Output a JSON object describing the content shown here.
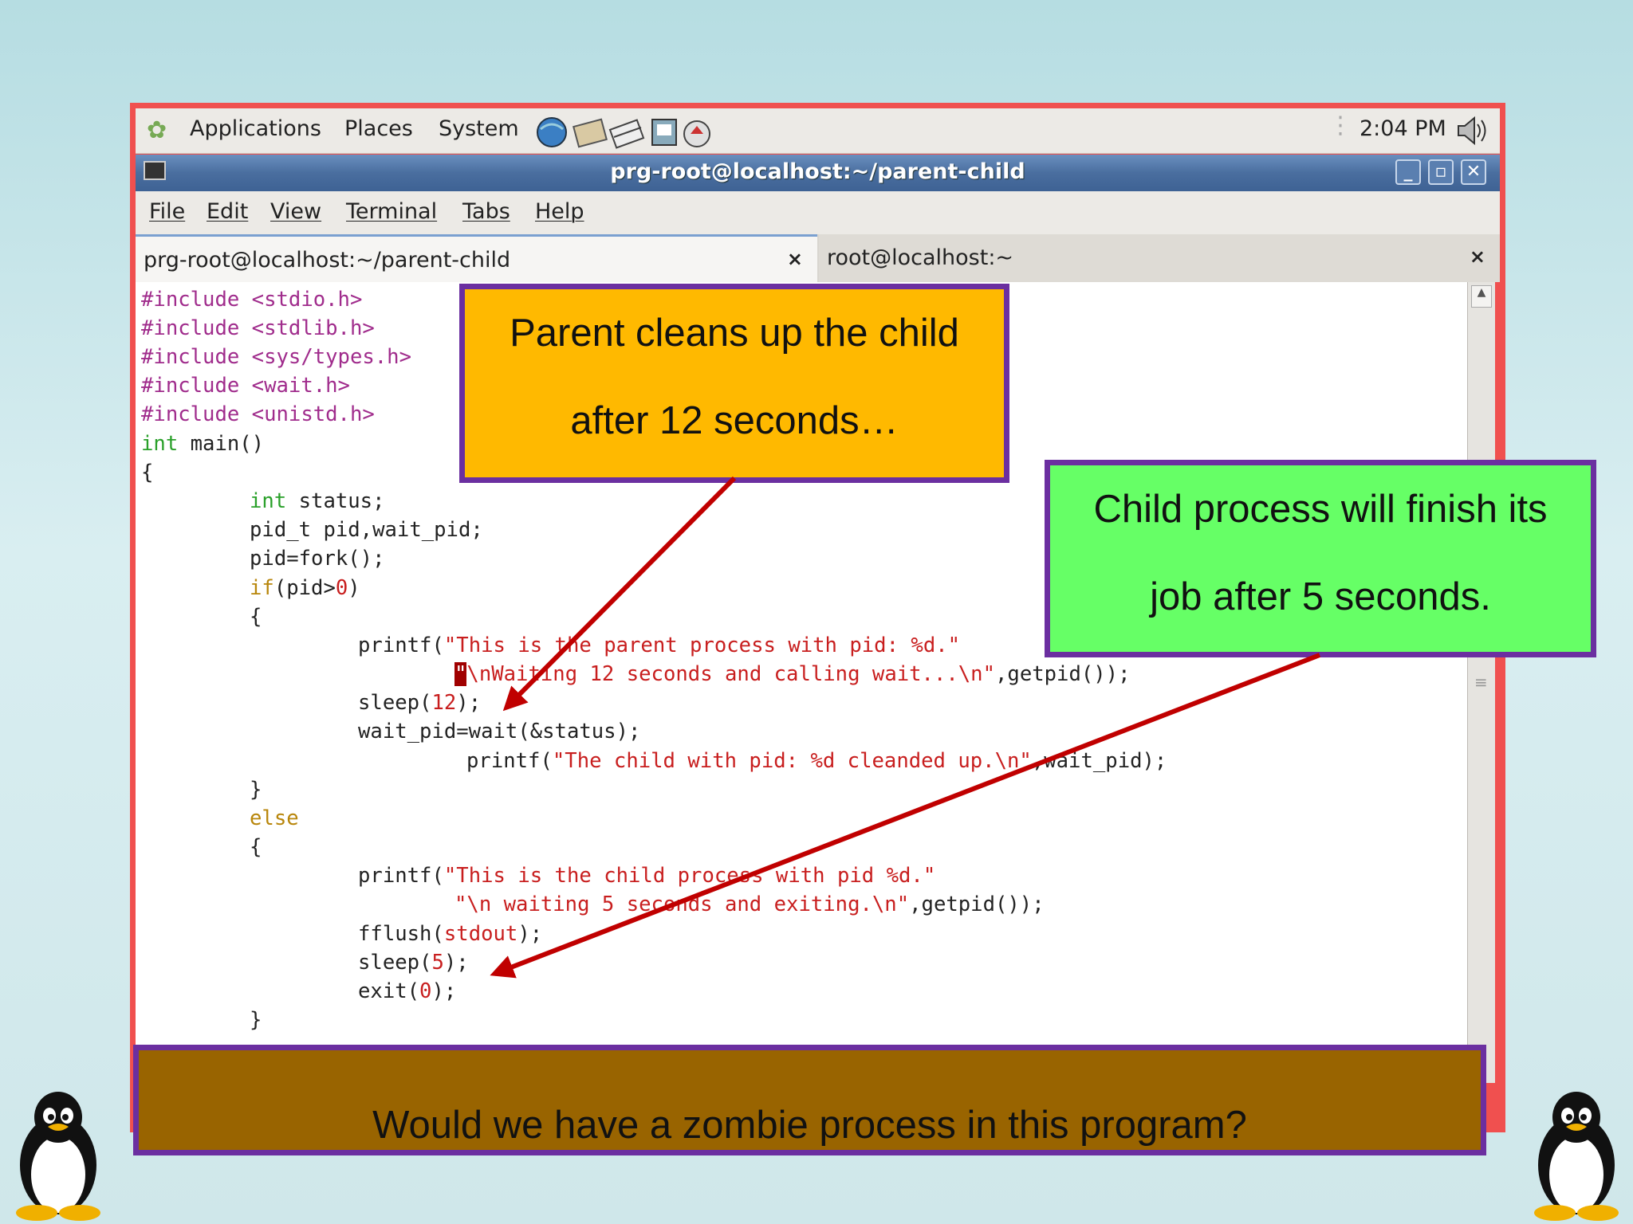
{
  "panel": {
    "applications": "Applications",
    "places": "Places",
    "system": "System",
    "launcher_icons": [
      "browser-icon",
      "mail-icon",
      "notes-icon",
      "screenshot-icon",
      "update-icon"
    ],
    "clock": "2:04 PM",
    "volume_icon": "volume-icon"
  },
  "window": {
    "title": "prg-root@localhost:~/parent-child",
    "controls": {
      "minimize": "_",
      "maximize": "▫",
      "close": "✕"
    }
  },
  "menubar": [
    "File",
    "Edit",
    "View",
    "Terminal",
    "Tabs",
    "Help"
  ],
  "tabs": [
    {
      "label": "prg-root@localhost:~/parent-child",
      "close": "×"
    },
    {
      "label": "root@localhost:~",
      "close": "×"
    }
  ],
  "code": {
    "includes": [
      "#include <stdio.h>",
      "#include <stdlib.h>",
      "#include <sys/types.h>",
      "#include <wait.h>",
      "#include <unistd.h>"
    ],
    "main_type": "int",
    "main_rest": " main()",
    "open_brace": "{",
    "status_type": "int",
    "status_rest": " status;",
    "pid_decl": "pid_t pid,wait_pid;",
    "fork_line": "pid=fork();",
    "if_kw": "if",
    "if_open": "(pid>",
    "if_num": "0",
    "if_close": ")",
    "inner_open": "{",
    "printf1_fn": "printf(",
    "printf1_str": "\"This is the parent process with pid: %d.\"",
    "printf1b_cursor": "\"",
    "printf1b_str": "\\nWaiting 12 seconds and calling wait...\\n\"",
    "printf1b_rest": ",getpid());",
    "sleep12_fn": "sleep(",
    "sleep12_num": "12",
    "sleep12_end": ");",
    "wait_line": "wait_pid=wait(&status);",
    "printf2_fn": "printf(",
    "printf2_str": "\"The child with pid: %d cleanded up.\\n\"",
    "printf2_rest": ",wait_pid);",
    "inner_close": "}",
    "else_kw": "else",
    "else_open": "{",
    "printf3_fn": "printf(",
    "printf3_str": "\"This is the child process with pid %d.\"",
    "printf3b_str": "\"\\n waiting 5 seconds and exiting.\\n\"",
    "printf3b_rest": ",getpid());",
    "fflush_fn": "fflush(",
    "fflush_arg": "stdout",
    "fflush_end": ");",
    "sleep5_fn": "sleep(",
    "sleep5_num": "5",
    "sleep5_end": ");",
    "exit_fn": "exit(",
    "exit_num": "0",
    "exit_end": ");",
    "else_close": "}"
  },
  "callouts": {
    "parent": [
      "Parent cleans up the child",
      "after 12 seconds…"
    ],
    "child": [
      "Child process will finish its",
      "job after  5 seconds."
    ],
    "question": "Would we have a zombie process in this program?"
  },
  "colors": {
    "frame": "#f0504f",
    "parent_callout": "#ffb900",
    "child_callout": "#66ff66",
    "question_callout": "#996400",
    "callout_border": "#6b2fa0",
    "arrow": "#c00000"
  }
}
